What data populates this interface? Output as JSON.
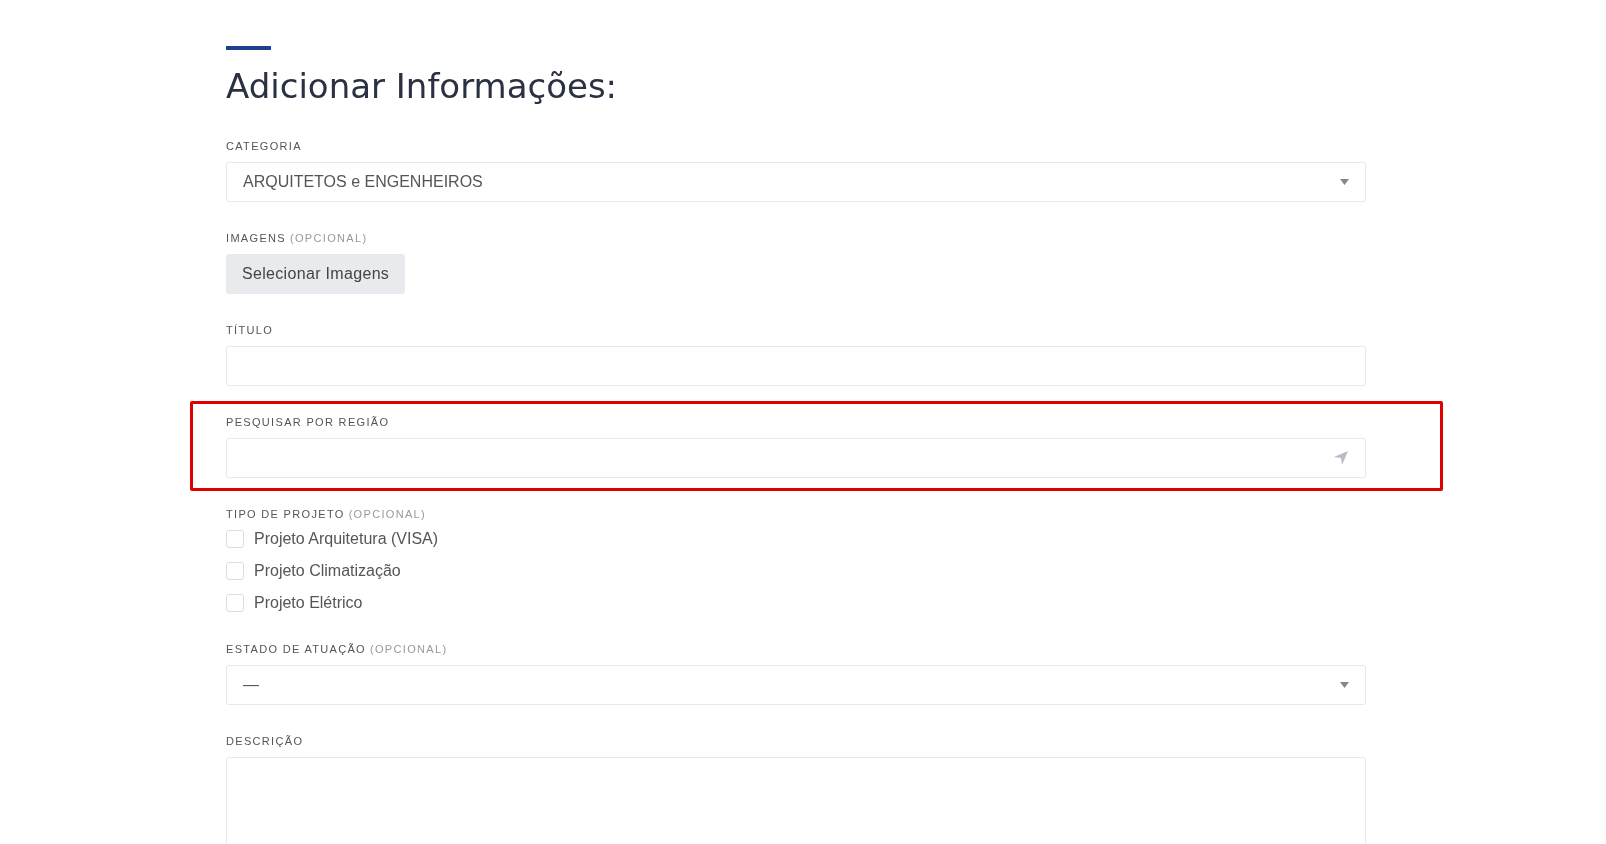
{
  "heading": "Adicionar Informações:",
  "fields": [
    {
      "kind": "select",
      "label": "CATEGORIA",
      "value": "ARQUITETOS e ENGENHEIROS"
    },
    {
      "kind": "upload",
      "label": "IMAGENS",
      "note": "(OPCIONAL)",
      "button": "Selecionar Imagens"
    },
    {
      "kind": "text",
      "label": "TÍTULO"
    },
    {
      "kind": "location",
      "label": "PESQUISAR POR REGIÃO",
      "highlighted": true
    },
    {
      "kind": "checkboxes",
      "label": "TIPO DE PROJETO",
      "note": "(OPCIONAL)",
      "options": [
        {
          "label": "Projeto Arquitetura (VISA)",
          "checked": false
        },
        {
          "label": "Projeto Climatização",
          "checked": false
        },
        {
          "label": "Projeto Elétrico",
          "checked": false
        }
      ]
    },
    {
      "kind": "select",
      "label": "ESTADO DE ATUAÇÃO",
      "note": "(OPCIONAL)",
      "value": "—"
    },
    {
      "kind": "textarea",
      "label": "DESCRIÇÃO"
    }
  ]
}
